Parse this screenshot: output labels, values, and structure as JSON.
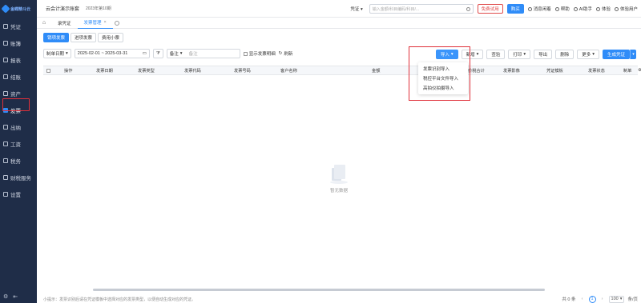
{
  "app": {
    "logo_text": "金蝶精斗云",
    "company": "云会计演示账套",
    "period": "2023年第10期"
  },
  "sidebar": {
    "items": [
      {
        "label": "凭证"
      },
      {
        "label": "账簿"
      },
      {
        "label": "报表"
      },
      {
        "label": "结账"
      },
      {
        "label": "资产"
      },
      {
        "label": "发票"
      },
      {
        "label": "出纳"
      },
      {
        "label": "工资"
      },
      {
        "label": "税务"
      },
      {
        "label": "财税服务"
      },
      {
        "label": "设置"
      }
    ],
    "active": "发票"
  },
  "topbar": {
    "voucher_select": "凭证",
    "search_placeholder": "输入金额/科目编码/科目/...",
    "trial_label": "免费试用",
    "buy_label": "购买",
    "links": [
      "消息闲着",
      "帮助",
      "AI助手",
      "体验",
      "体验用户"
    ]
  },
  "tabs": [
    {
      "label": "录凭证",
      "active": false
    },
    {
      "label": "发票管理",
      "active": true
    }
  ],
  "subtabs": [
    {
      "label": "销项发票",
      "active": true
    },
    {
      "label": "进项发票",
      "active": false
    },
    {
      "label": "费用小票",
      "active": false
    }
  ],
  "filters": {
    "date_type": "制单日期",
    "date_range": "2025-02-01 ~ 2025-03-31",
    "remark_label": "备注",
    "remark_placeholder": "备注",
    "show_detail": "显示发票明细",
    "refresh": "刷新"
  },
  "actions": {
    "import": "导入",
    "add": "新增",
    "check": "查验",
    "print": "打印",
    "export": "导出",
    "delete": "删除",
    "more": "更多",
    "generate": "生成凭证"
  },
  "import_menu": {
    "items": [
      "发票识别导入",
      "税控平台文件导入",
      "高拍仪拍摄导入"
    ]
  },
  "table": {
    "headers": [
      "操作",
      "发票日期",
      "发票类型",
      "发票代码",
      "发票号码",
      "客户名称",
      "金额",
      "价税合计",
      "发票影像",
      "凭证模板",
      "发票状态",
      "制单"
    ],
    "empty_text": "暂无数据"
  },
  "footer": {
    "tip": "小提示：发票识别后请在凭证模板中选择对应的发票类型，以便自动生成对应的凭证。",
    "total": "共 0 条",
    "page": "1",
    "page_size": "100",
    "page_unit": "条/页"
  }
}
